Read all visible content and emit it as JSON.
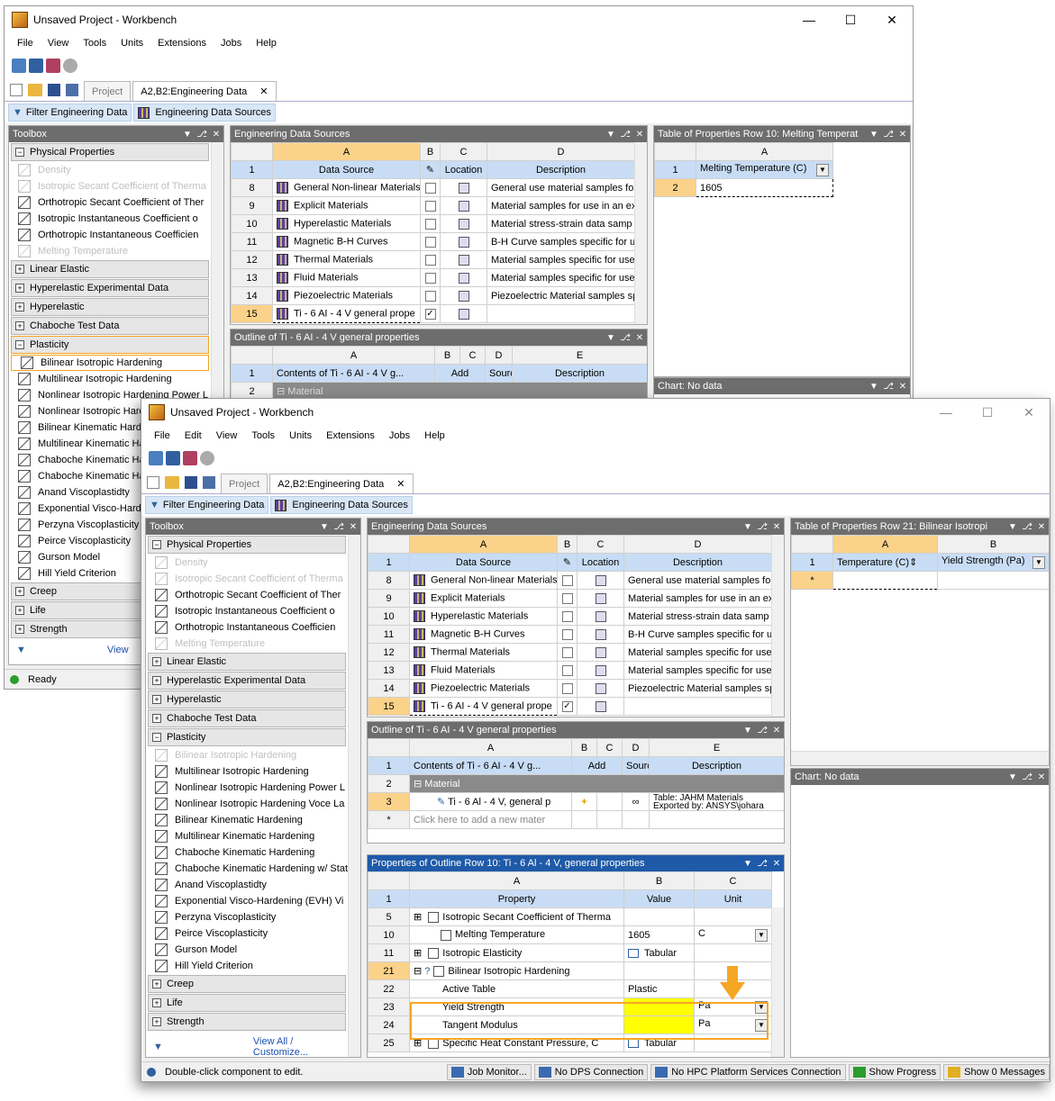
{
  "window_title": "Unsaved Project - Workbench",
  "menu": [
    "File",
    "View",
    "Tools",
    "Units",
    "Extensions",
    "Jobs",
    "Help"
  ],
  "menu2": [
    "File",
    "Edit",
    "View",
    "Tools",
    "Units",
    "Extensions",
    "Jobs",
    "Help"
  ],
  "tabs": {
    "project": "Project",
    "engdata": "A2,B2:Engineering Data"
  },
  "toolbar": {
    "filter": "Filter Engineering Data",
    "sources": "Engineering Data Sources"
  },
  "toolbox": {
    "title": "Toolbox",
    "physical": "Physical Properties",
    "physical_items": [
      "Density",
      "Isotropic Secant Coefficient of Therma",
      "Orthotropic Secant Coefficient of Ther",
      "Isotropic Instantaneous Coefficient o",
      "Orthotropic Instantaneous Coefficien",
      "Melting Temperature"
    ],
    "groups_a": [
      "Linear Elastic",
      "Hyperelastic Experimental Data",
      "Hyperelastic",
      "Chaboche Test Data"
    ],
    "plasticity": "Plasticity",
    "plasticity_items_1": [
      "Bilinear Isotropic Hardening",
      "Multilinear Isotropic Hardening",
      "Nonlinear Isotropic Hardening Power L",
      "Nonlinear Isotropic Hardening Voce La",
      "Bilinear Kinematic Hard",
      "Multilinear Kinematic Ha",
      "Chaboche Kinematic Ha",
      "Chaboche Kinematic Ha",
      "Anand Viscoplastidty",
      "Exponential Visco-Hard",
      "Perzyna Viscoplasticity",
      "Peirce Viscoplasticity",
      "Gurson Model",
      "Hill Yield Criterion"
    ],
    "plasticity_items_2": [
      "Bilinear Isotropic Hardening",
      "Multilinear Isotropic Hardening",
      "Nonlinear Isotropic Hardening Power L",
      "Nonlinear Isotropic Hardening Voce La",
      "Bilinear Kinematic Hardening",
      "Multilinear Kinematic Hardening",
      "Chaboche Kinematic Hardening",
      "Chaboche Kinematic Hardening w/ Stat",
      "Anand Viscoplastidty",
      "Exponential Visco-Hardening (EVH) Vi",
      "Perzyna Viscoplasticity",
      "Peirce Viscoplasticity",
      "Gurson Model",
      "Hill Yield Criterion"
    ],
    "groups_b": [
      "Creep",
      "Life",
      "Strength"
    ],
    "view_all": "View All / Customize...",
    "view_short": "View"
  },
  "sources": {
    "title": "Engineering Data Sources",
    "cols": [
      "A",
      "B",
      "C",
      "D"
    ],
    "heads": [
      "Data Source",
      "",
      "Location",
      "Description"
    ],
    "rows": [
      {
        "n": "8",
        "name": "General Non-linear Materials",
        "desc": "General use material samples for"
      },
      {
        "n": "9",
        "name": "Explicit Materials",
        "desc": "Material samples for use in an ex"
      },
      {
        "n": "10",
        "name": "Hyperelastic Materials",
        "desc": "Material stress-strain data samp"
      },
      {
        "n": "11",
        "name": "Magnetic B-H Curves",
        "desc": "B-H Curve samples specific for u"
      },
      {
        "n": "12",
        "name": "Thermal Materials",
        "desc": "Material samples specific for use"
      },
      {
        "n": "13",
        "name": "Fluid Materials",
        "desc": "Material samples specific for use"
      },
      {
        "n": "14",
        "name": "Piezoelectric Materials",
        "desc": "Piezoelectric Material samples sp"
      },
      {
        "n": "15",
        "name": "Ti - 6 AI - 4 V general prope",
        "desc": ""
      }
    ]
  },
  "outline": {
    "title": "Outline of Ti - 6 AI - 4 V general properties",
    "cols": [
      "A",
      "B",
      "C",
      "D",
      "E"
    ],
    "heads": [
      "Contents of Ti - 6 AI - 4 V g...",
      "Add",
      "Source",
      "Description"
    ],
    "material": "Material",
    "row3": "Ti - 6 Al - 4 V, general p",
    "row3desc1": "Table: JAHM Materials",
    "row3desc2": "Exported by: ANSYS\\johara",
    "click_add": "Click here to add a new mater"
  },
  "table1": {
    "title": "Table of Properties Row 10: Melting Temperat",
    "col": "A",
    "head": "Melting Temperature (C)",
    "val": "1605"
  },
  "table2": {
    "title": "Table of Properties Row 21: Bilinear Isotropi",
    "colA": "A",
    "colB": "B",
    "headA": "Temperature (C)",
    "headB": "Yield Strength (Pa)",
    "star": "*"
  },
  "chart": {
    "title": "Chart: No data"
  },
  "props": {
    "title": "Properties of Outline Row 10: Ti - 6 Al - 4 V, general properties",
    "cols": [
      "A",
      "B",
      "C"
    ],
    "heads": [
      "Property",
      "Value",
      "Unit"
    ],
    "rows": [
      {
        "n": "5",
        "name": "Isotropic Secant Coefficient of Therma",
        "val": "",
        "unit": ""
      },
      {
        "n": "10",
        "name": "Melting Temperature",
        "val": "1605",
        "unit": "C"
      },
      {
        "n": "11",
        "name": "Isotropic Elasticity",
        "val": "Tabular",
        "unit": ""
      },
      {
        "n": "21",
        "name": "Bilinear Isotropic Hardening",
        "val": "",
        "unit": ""
      },
      {
        "n": "22",
        "name": "Active Table",
        "val": "Plastic",
        "unit": ""
      },
      {
        "n": "23",
        "name": "Yield Strength",
        "val": "",
        "unit": "Pa"
      },
      {
        "n": "24",
        "name": "Tangent Modulus",
        "val": "",
        "unit": "Pa"
      },
      {
        "n": "25",
        "name": "Specific Heat Constant Pressure, C",
        "val": "Tabular",
        "unit": ""
      }
    ]
  },
  "status": {
    "ready": "Ready",
    "hint": "Double-click component to edit.",
    "job": "Job Monitor...",
    "dps": "No DPS Connection",
    "hpc": "No HPC Platform Services Connection",
    "progress": "Show Progress",
    "messages": "Show 0 Messages"
  },
  "colors": {
    "accent": "#f5a623",
    "header": "#6d6d6d",
    "yellow": "#ffff00"
  }
}
